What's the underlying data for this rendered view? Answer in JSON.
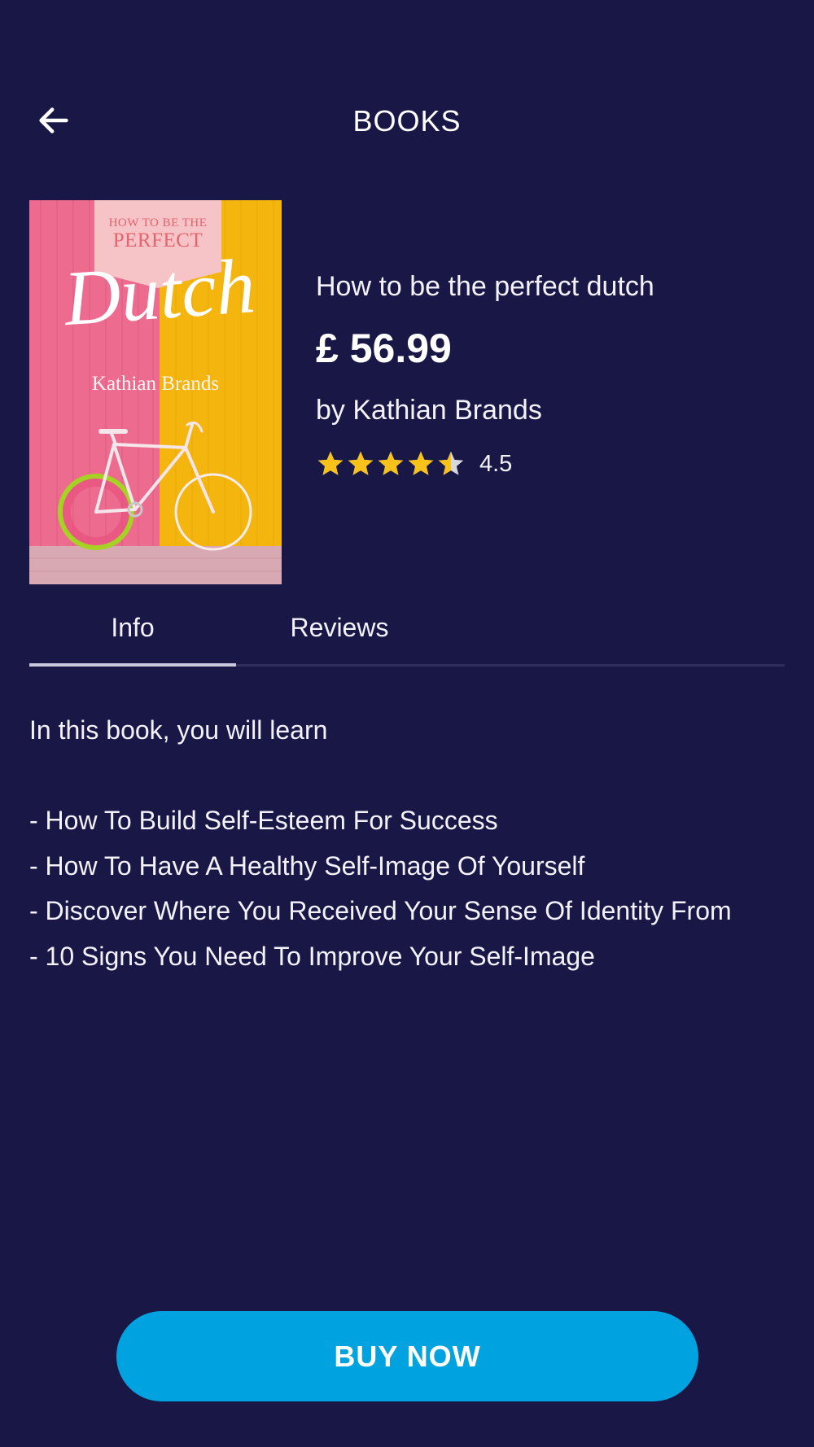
{
  "header": {
    "title": "BOOKS",
    "back_icon": "arrow-left-icon"
  },
  "book": {
    "cover": {
      "top_line": "HOW TO BE THE",
      "second_line": "PERFECT",
      "script_title": "Dutch",
      "author": "Kathian Brands",
      "colors": {
        "pink": "#ec6b8f",
        "yellow": "#f5b50f",
        "banner": "#f6c3c6",
        "ground": "#d9a9b3"
      }
    },
    "title": "How to be the perfect dutch",
    "price": "£ 56.99",
    "author": "by Kathian Brands",
    "rating": {
      "value": 4.5,
      "label": "4.5",
      "max": 5,
      "star_color": "#f8c21b",
      "empty_color": "#d6d6de"
    }
  },
  "tabs": [
    {
      "label": "Info",
      "active": true
    },
    {
      "label": "Reviews",
      "active": false
    }
  ],
  "description": {
    "intro": "In this book, you will learn",
    "points": [
      "- How To Build Self-Esteem For Success",
      "- How To Have A Healthy Self-Image Of Yourself",
      "- Discover Where You Received Your Sense Of Identity From",
      "- 10 Signs You Need To Improve Your Self-Image"
    ]
  },
  "cta": {
    "label": "BUY NOW",
    "color": "#00a3e0"
  },
  "theme": {
    "background": "#191746",
    "text": "#ffffff"
  }
}
